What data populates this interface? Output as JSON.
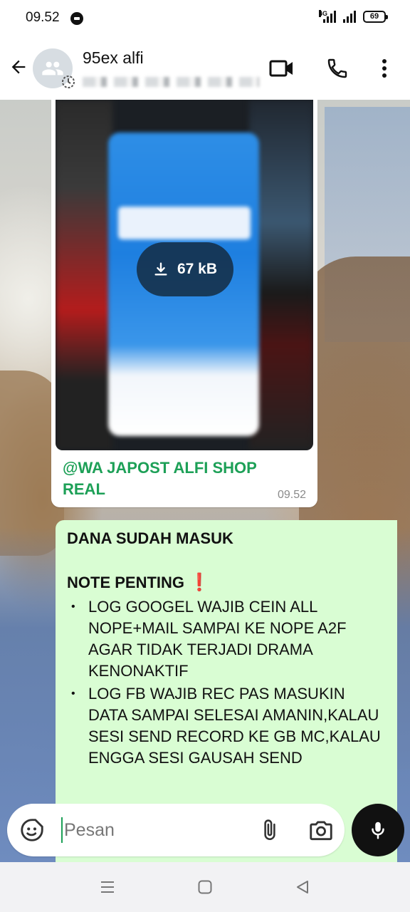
{
  "status_bar": {
    "time": "09.52",
    "network_label": "4G",
    "battery": "69"
  },
  "header": {
    "contact_name": "95ex alfi",
    "icons": [
      "back-arrow-icon",
      "group-avatar-icon",
      "disappearing-timer-icon",
      "video-call-icon",
      "voice-call-icon",
      "more-vert-icon"
    ]
  },
  "messages": {
    "incoming": {
      "download_size": "67 kB",
      "caption": "@WA JAPOST ALFI SHOP REAL",
      "time": "09.52"
    },
    "outgoing": {
      "line1": "DANA SUDAH MASUK",
      "note_title": "NOTE PENTING",
      "note_mark": "❗",
      "items": [
        "LOG GOOGEL WAJIB CEIN ALL NOPE+MAIL SAMPAI KE NOPE A2F AGAR TIDAK TERJADI DRAMA KENONAKTIF",
        "LOG FB WAJIB REC PAS MASUKIN DATA SAMPAI SELESAI AMANIN,KALAU SESI SEND RECORD KE GB MC,KALAU ENGGA SESI GAUSAH SEND"
      ]
    }
  },
  "input": {
    "placeholder": "Pesan"
  },
  "colors": {
    "accent_green": "#1da057",
    "outgoing_bubble": "#d9fdd3",
    "incoming_bubble": "#ffffff",
    "mic_button": "#111111"
  }
}
